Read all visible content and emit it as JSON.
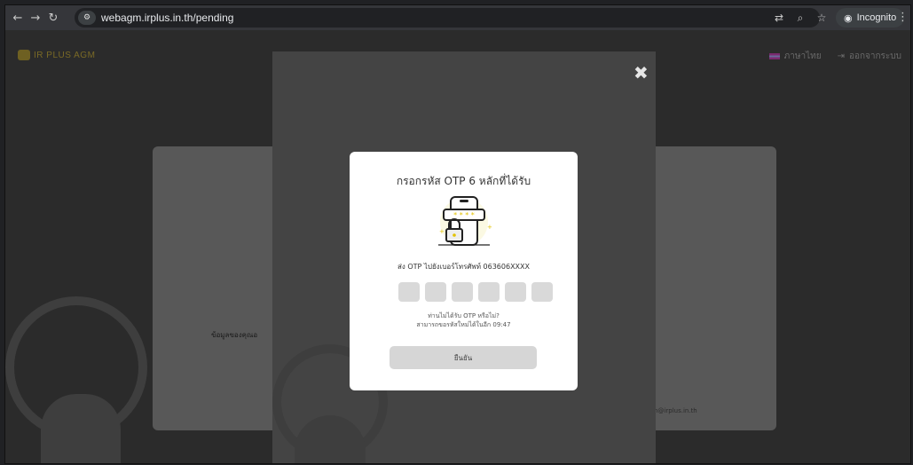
{
  "browser": {
    "url": "webagm.irplus.in.th/pending",
    "incognito_label": "Incognito"
  },
  "header": {
    "logo_text": "IR PLUS AGM",
    "language_label": "ภาษาไทย",
    "logout_label": "ออกจากระบบ"
  },
  "background": {
    "card_label": "ข้อมูลของคุณอ",
    "email_partial": "n@irplus.in.th"
  },
  "otp_dialog": {
    "title": "กรอกรหัส OTP 6 หลักที่ได้รับ",
    "sent_to": "ส่ง OTP ไปยังเบอร์โทรศัพท์ 063606XXXX",
    "digits": [
      "",
      "",
      "",
      "",
      "",
      ""
    ],
    "not_received": "ท่านไม่ได้รับ OTP หรือไม่?",
    "resend_countdown": "สามารถขอรหัสใหม่ได้ในอีก 09:47",
    "confirm_label": "ยืนยัน",
    "close_icon": "close-icon"
  }
}
